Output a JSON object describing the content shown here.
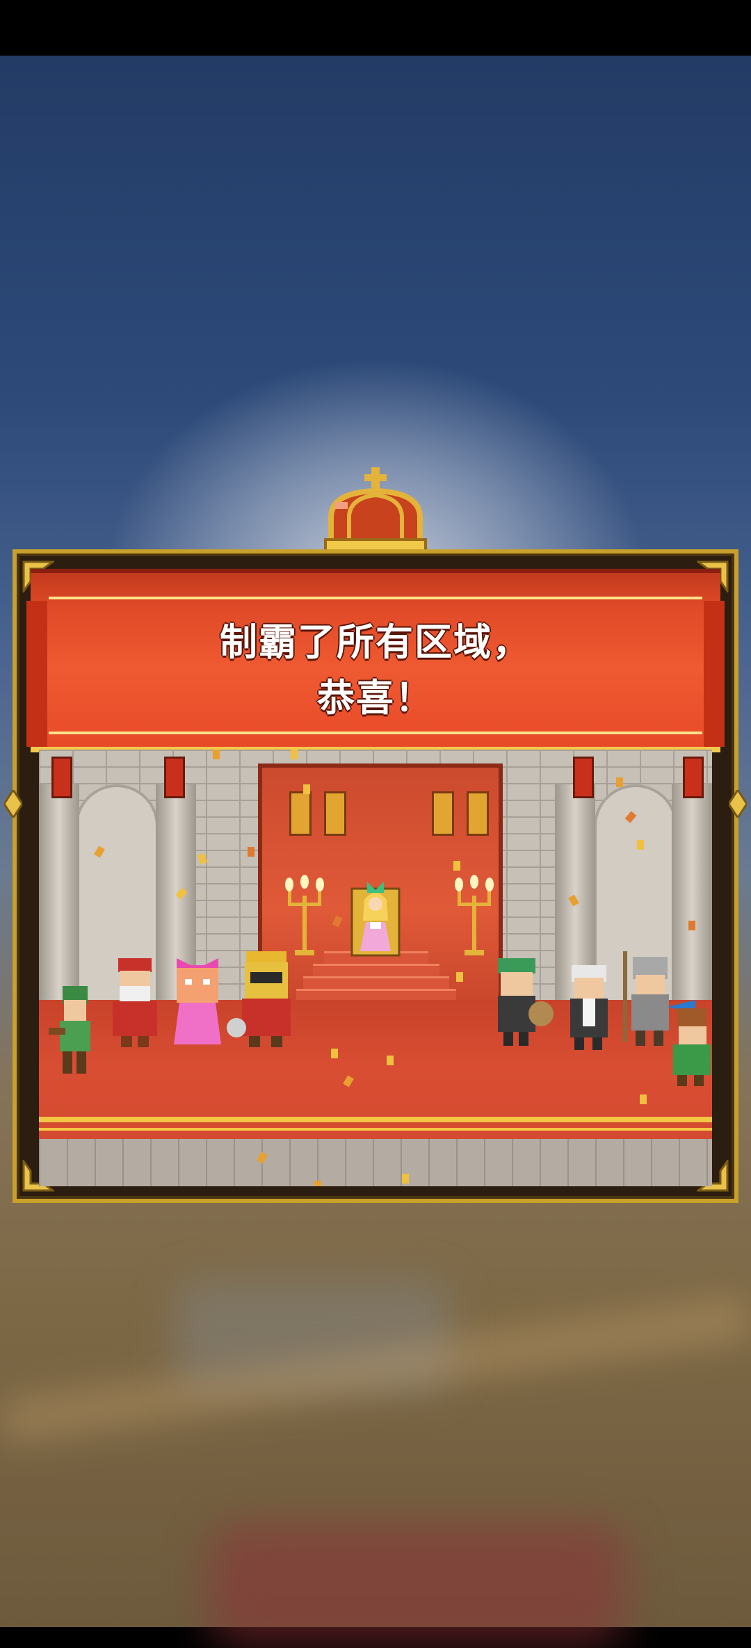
{
  "message": {
    "line1": "制霸了所有区域，",
    "line2": "恭喜！"
  },
  "colors": {
    "banner_red": "#e84a28",
    "gold": "#f3c94a",
    "frame_gold": "#c8a02a"
  },
  "icons": [
    "crown-icon",
    "banner-flag",
    "candelabra",
    "throne"
  ],
  "characters": [
    "green-archer",
    "red-bearded-king",
    "pink-bow-girl",
    "gold-helmet-knight",
    "throne-princess",
    "green-hat-merchant",
    "elder-scholar",
    "spear-soldier",
    "green-hunter"
  ]
}
